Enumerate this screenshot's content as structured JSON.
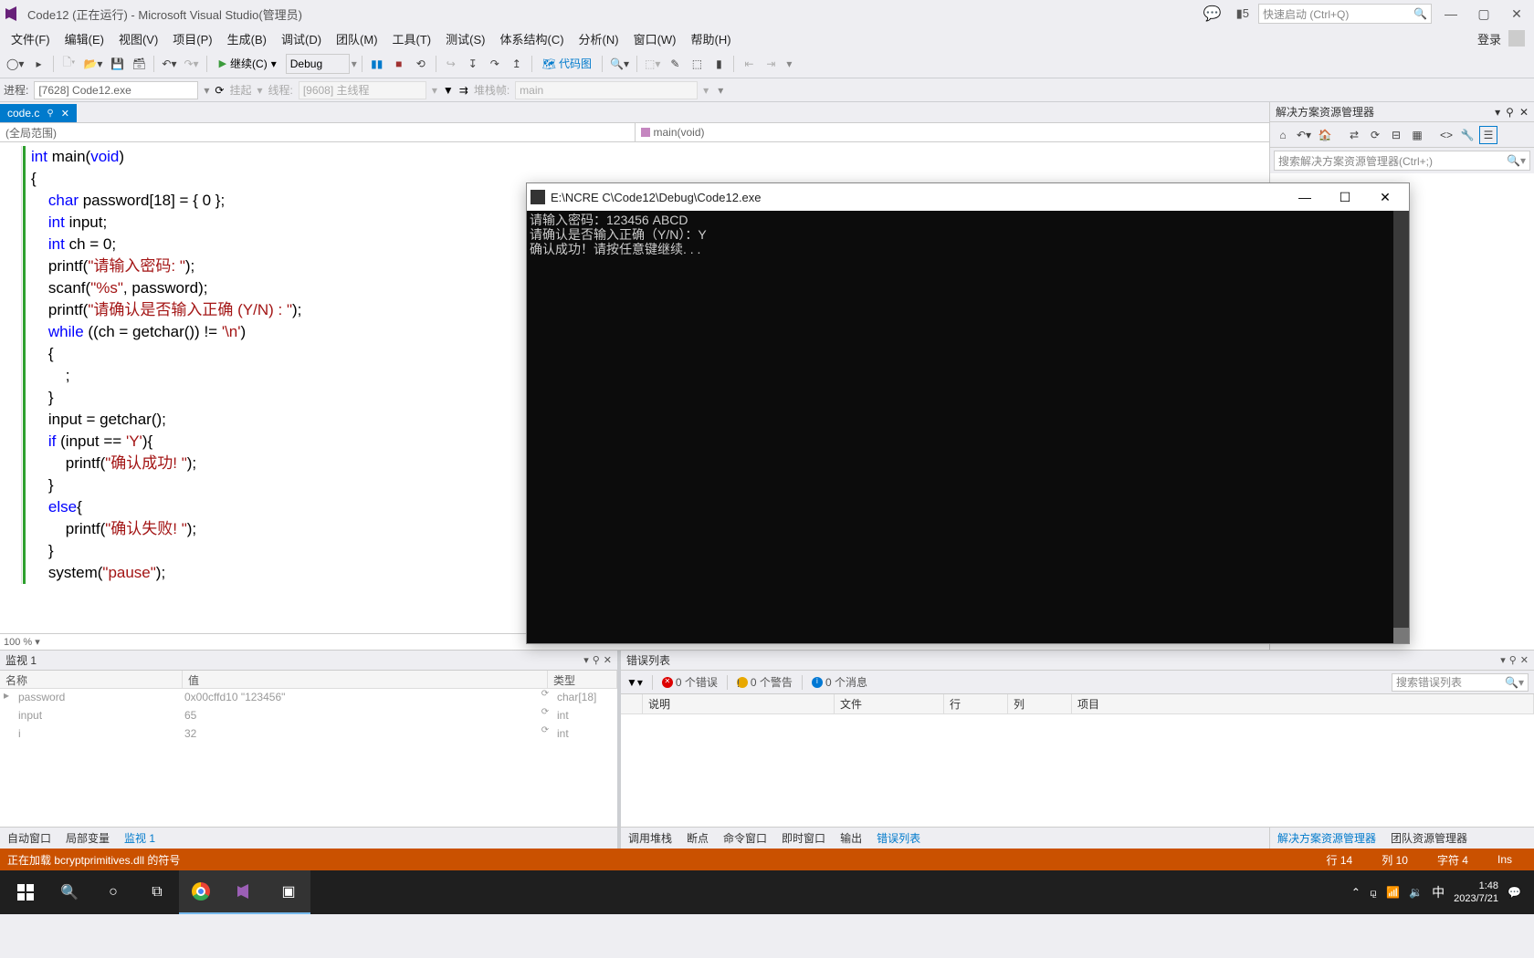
{
  "titlebar": {
    "title": "Code12 (正在运行) - Microsoft Visual Studio(管理员)",
    "flag_count": "5",
    "quicklaunch_placeholder": "快速启动 (Ctrl+Q)"
  },
  "menubar": {
    "items": [
      "文件(F)",
      "编辑(E)",
      "视图(V)",
      "项目(P)",
      "生成(B)",
      "调试(D)",
      "团队(M)",
      "工具(T)",
      "测试(S)",
      "体系结构(C)",
      "分析(N)",
      "窗口(W)",
      "帮助(H)"
    ],
    "login": "登录"
  },
  "toolbar": {
    "continue_label": "继续(C)",
    "config": "Debug",
    "codemap_label": "代码图"
  },
  "toolbar2": {
    "process_label": "进程:",
    "process_value": "[7628] Code12.exe",
    "suspend_label": "挂起",
    "thread_label": "线程:",
    "thread_value": "[9608] 主线程",
    "stackframe_label": "堆栈帧:",
    "stackframe_value": "main"
  },
  "filetab": {
    "name": "code.c"
  },
  "navbar": {
    "scope": "(全局范围)",
    "func": "main(void)"
  },
  "code_tokens": [
    [
      {
        "t": "ty",
        "v": "int"
      },
      {
        "t": "",
        "v": " main("
      },
      {
        "t": "ty",
        "v": "void"
      },
      {
        "t": "",
        "v": ")"
      }
    ],
    [
      {
        "t": "",
        "v": "{"
      }
    ],
    [
      {
        "t": "",
        "v": "    "
      },
      {
        "t": "ty",
        "v": "char"
      },
      {
        "t": "",
        "v": " password[18] = { 0 };"
      }
    ],
    [
      {
        "t": "",
        "v": "    "
      },
      {
        "t": "ty",
        "v": "int"
      },
      {
        "t": "",
        "v": " input;"
      }
    ],
    [
      {
        "t": "",
        "v": "    "
      },
      {
        "t": "ty",
        "v": "int"
      },
      {
        "t": "",
        "v": " ch = 0;"
      }
    ],
    [
      {
        "t": "",
        "v": "    printf("
      },
      {
        "t": "str",
        "v": "\"请输入密码: \""
      },
      {
        "t": "",
        "v": ");"
      }
    ],
    [
      {
        "t": "",
        "v": "    scanf("
      },
      {
        "t": "str",
        "v": "\"%s\""
      },
      {
        "t": "",
        "v": ", password);"
      }
    ],
    [
      {
        "t": "",
        "v": "    printf("
      },
      {
        "t": "str",
        "v": "\"请确认是否输入正确 (Y/N) : \""
      },
      {
        "t": "",
        "v": ");"
      }
    ],
    [
      {
        "t": "",
        "v": "    "
      },
      {
        "t": "kw",
        "v": "while"
      },
      {
        "t": "",
        "v": " ((ch = getchar()) != "
      },
      {
        "t": "str",
        "v": "'\\n'"
      },
      {
        "t": "",
        "v": ")"
      }
    ],
    [
      {
        "t": "",
        "v": "    {"
      }
    ],
    [
      {
        "t": "",
        "v": "        ;"
      }
    ],
    [
      {
        "t": "",
        "v": "    }"
      }
    ],
    [
      {
        "t": "",
        "v": "    input = getchar();"
      }
    ],
    [
      {
        "t": "",
        "v": "    "
      },
      {
        "t": "kw",
        "v": "if"
      },
      {
        "t": "",
        "v": " (input == "
      },
      {
        "t": "str",
        "v": "'Y'"
      },
      {
        "t": "",
        "v": "){"
      }
    ],
    [
      {
        "t": "",
        "v": "        printf("
      },
      {
        "t": "str",
        "v": "\"确认成功! \""
      },
      {
        "t": "",
        "v": ");"
      }
    ],
    [
      {
        "t": "",
        "v": "    }"
      }
    ],
    [
      {
        "t": "",
        "v": "    "
      },
      {
        "t": "kw",
        "v": "else"
      },
      {
        "t": "",
        "v": "{"
      }
    ],
    [
      {
        "t": "",
        "v": "        printf("
      },
      {
        "t": "str",
        "v": "\"确认失败! \""
      },
      {
        "t": "",
        "v": ");"
      }
    ],
    [
      {
        "t": "",
        "v": "    }"
      }
    ],
    [
      {
        "t": "",
        "v": "    system("
      },
      {
        "t": "str",
        "v": "\"pause\""
      },
      {
        "t": "",
        "v": ");"
      }
    ]
  ],
  "zoom": "100 %",
  "soln": {
    "title": "解决方案资源管理器",
    "search_placeholder": "搜索解决方案资源管理器(Ctrl+;)"
  },
  "console": {
    "title": "E:\\NCRE C\\Code12\\Debug\\Code12.exe",
    "lines": [
      "请输入密码：123456 ABCD",
      "请确认是否输入正确（Y/N）：Y",
      "确认成功！请按任意键继续. . ."
    ]
  },
  "watch": {
    "title": "监视 1",
    "cols": {
      "name": "名称",
      "value": "值",
      "type": "类型"
    },
    "rows": [
      {
        "name": "password",
        "value": "0x00cffd10 \"123456\"",
        "type": "char[18]",
        "expandable": true
      },
      {
        "name": "input",
        "value": "65",
        "type": "int",
        "expandable": false
      },
      {
        "name": "i",
        "value": "32",
        "type": "int",
        "expandable": false
      }
    ]
  },
  "errors": {
    "title": "错误列表",
    "filter": "▼",
    "counts": {
      "err": "0 个错误",
      "warn": "0 个警告",
      "msg": "0 个消息"
    },
    "search_placeholder": "搜索错误列表",
    "cols": {
      "desc": "说明",
      "file": "文件",
      "line": "行",
      "col": "列",
      "proj": "项目"
    }
  },
  "bottabs": {
    "left": [
      "自动窗口",
      "局部变量",
      "监视 1"
    ],
    "left_active": 2,
    "mid": [
      "调用堆栈",
      "断点",
      "命令窗口",
      "即时窗口",
      "输出",
      "错误列表"
    ],
    "mid_active": 5,
    "right": [
      "解决方案资源管理器",
      "团队资源管理器"
    ],
    "right_active": 0
  },
  "status": {
    "msg": "正在加载 bcryptprimitives.dll 的符号",
    "line_lbl": "行",
    "line": "14",
    "col_lbl": "列",
    "col": "10",
    "char_lbl": "字符",
    "char": "4",
    "ins": "Ins"
  },
  "taskbar": {
    "ime": "中",
    "time": "1:48",
    "date": "2023/7/21"
  }
}
